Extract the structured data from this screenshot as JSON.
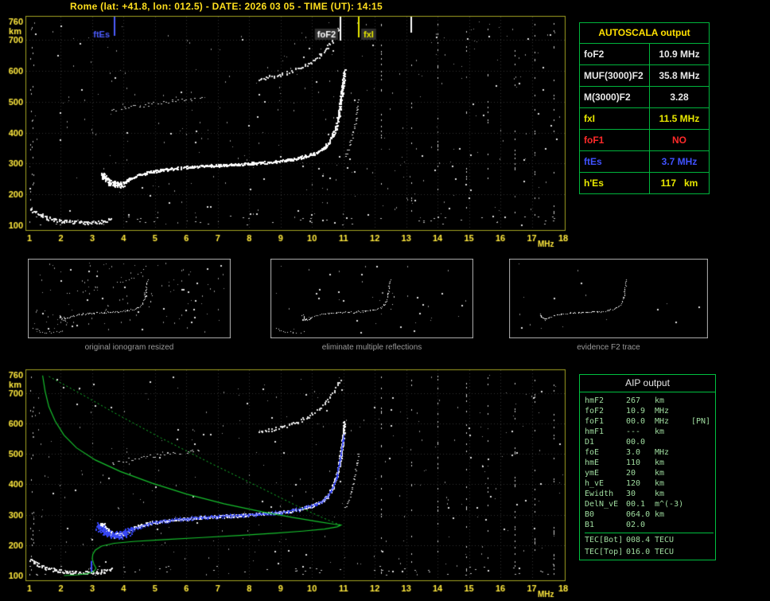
{
  "header": {
    "title": "Rome (lat: +41.8, lon: 012.5) - DATE: 2026 03 05 - TIME (UT): 14:15"
  },
  "tables": {
    "autoscala": {
      "title": "AUTOSCALA output",
      "rows": [
        {
          "label": "foF2",
          "value": "10.9 MHz",
          "color": "#e8e8e8"
        },
        {
          "label": "MUF(3000)F2",
          "value": "35.8 MHz",
          "color": "#e8e8e8"
        },
        {
          "label": "M(3000)F2",
          "value": "3.28",
          "color": "#e8e8e8"
        },
        {
          "label": "fxI",
          "value": "11.5 MHz",
          "color": "#e8e800"
        },
        {
          "label": "foF1",
          "value": "NO",
          "color": "#ff2a2a"
        },
        {
          "label": "ftEs",
          "value": "3.7 MHz",
          "color": "#4052ff"
        },
        {
          "label": "h'Es",
          "value": "117   km",
          "color": "#e8e800"
        }
      ]
    },
    "aip": {
      "title": "AIP output",
      "rows": [
        {
          "name": "hmF2",
          "value": "267",
          "unit": "km",
          "extra": ""
        },
        {
          "name": "foF2",
          "value": "10.9",
          "unit": "MHz",
          "extra": ""
        },
        {
          "name": "foF1",
          "value": "00.0",
          "unit": "MHz",
          "extra": "[PN]"
        },
        {
          "name": "hmF1",
          "value": "---",
          "unit": "km",
          "extra": ""
        },
        {
          "name": "D1",
          "value": "00.0",
          "unit": "",
          "extra": ""
        },
        {
          "name": "foE",
          "value": "3.0",
          "unit": "MHz",
          "extra": ""
        },
        {
          "name": "hmE",
          "value": "110",
          "unit": "km",
          "extra": ""
        },
        {
          "name": "ymE",
          "value": "20",
          "unit": "km",
          "extra": ""
        },
        {
          "name": "h_vE",
          "value": "120",
          "unit": "km",
          "extra": ""
        },
        {
          "name": "Ewidth",
          "value": "30",
          "unit": "km",
          "extra": ""
        },
        {
          "name": "DelN_vE",
          "value": "00.1",
          "unit": "m^(-3)",
          "extra": ""
        },
        {
          "name": "B0",
          "value": "064.0",
          "unit": "km",
          "extra": ""
        },
        {
          "name": "B1",
          "value": "02.0",
          "unit": "",
          "extra": ""
        },
        {
          "name": "TEC[Bot]",
          "value": "008.4",
          "unit": "TECU",
          "extra": ""
        },
        {
          "name": "TEC[Top]",
          "value": "016.0",
          "unit": "TECU",
          "extra": ""
        }
      ]
    }
  },
  "thumbnails": [
    {
      "caption": "original ionogram resized",
      "traces": [
        "e_layer",
        "f_cusp",
        "f_trace",
        "x_trace",
        "multiple_f",
        "multiple_low"
      ],
      "noise": 130
    },
    {
      "caption": "eliminate multiple reflections",
      "traces": [
        "e_layer",
        "f_cusp",
        "f_trace",
        "x_trace"
      ],
      "noise": 45
    },
    {
      "caption": "evidence F2 trace",
      "traces": [
        "f_cusp",
        "f_trace"
      ],
      "noise": 16
    }
  ],
  "chart_data": {
    "type": "scatter",
    "title": "Ionogram",
    "x_label": "MHz",
    "y_label": "km",
    "x_range": [
      1,
      18
    ],
    "y_range": [
      100,
      760
    ],
    "x_ticks": [
      1,
      2,
      3,
      4,
      5,
      6,
      7,
      8,
      9,
      10,
      11,
      12,
      13,
      14,
      15,
      16,
      17,
      18
    ],
    "y_ticks": [
      100,
      200,
      300,
      400,
      500,
      600,
      700,
      760
    ],
    "grid": true,
    "colors": {
      "trace": "#ffffff",
      "blue_overlay": "#2b3cf0",
      "profile_green": "#17c22e",
      "axis_yellow": "#ffe93e"
    },
    "scaled_values": {
      "foF2_mhz": 10.9,
      "fxI_mhz": 11.5,
      "ftEs_mhz": 3.7,
      "hEs_km": 117,
      "hmF2_km": 267,
      "foE_mhz": 3.0,
      "hmE_km": 110
    },
    "markers": [
      {
        "name": "ftEs",
        "label": "ftEs",
        "freq_mhz": 3.7,
        "color": "#4d5dff",
        "side": "left",
        "len": 24,
        "bg": false
      },
      {
        "name": "foF2",
        "label": "foF2",
        "freq_mhz": 10.9,
        "color": "#ffffff",
        "side": "left",
        "len": 30,
        "bg": true
      },
      {
        "name": "fxI",
        "label": "fxI",
        "freq_mhz": 11.5,
        "color": "#e8e800",
        "side": "right",
        "len": 26,
        "bg": true
      }
    ],
    "traces": {
      "e_layer": [
        [
          1.0,
          152
        ],
        [
          1.25,
          136
        ],
        [
          1.55,
          124
        ],
        [
          1.9,
          116
        ],
        [
          2.3,
          111
        ],
        [
          2.8,
          109
        ],
        [
          3.2,
          110
        ],
        [
          3.45,
          114
        ],
        [
          3.6,
          121
        ]
      ],
      "f_cusp": [
        [
          3.3,
          268
        ],
        [
          3.42,
          252
        ],
        [
          3.55,
          241
        ],
        [
          3.7,
          234
        ],
        [
          3.85,
          231
        ],
        [
          4.0,
          235
        ]
      ],
      "f_trace": [
        [
          4.0,
          237
        ],
        [
          4.2,
          249
        ],
        [
          4.5,
          263
        ],
        [
          4.9,
          274
        ],
        [
          5.5,
          283
        ],
        [
          6.2,
          289
        ],
        [
          7.0,
          294
        ],
        [
          7.8,
          298
        ],
        [
          8.5,
          303
        ],
        [
          9.1,
          309
        ],
        [
          9.6,
          318
        ],
        [
          10.0,
          329
        ],
        [
          10.3,
          344
        ],
        [
          10.5,
          363
        ],
        [
          10.65,
          388
        ],
        [
          10.77,
          420
        ],
        [
          10.86,
          460
        ],
        [
          10.93,
          510
        ],
        [
          10.99,
          558
        ],
        [
          11.04,
          605
        ]
      ],
      "x_trace": [
        [
          11.05,
          320
        ],
        [
          11.18,
          352
        ],
        [
          11.3,
          395
        ],
        [
          11.4,
          448
        ],
        [
          11.47,
          505
        ]
      ],
      "multiple_f": [
        [
          8.3,
          572
        ],
        [
          8.8,
          583
        ],
        [
          9.3,
          597
        ],
        [
          9.7,
          613
        ],
        [
          10.05,
          634
        ],
        [
          10.35,
          660
        ],
        [
          10.6,
          690
        ],
        [
          10.78,
          722
        ],
        [
          10.9,
          748
        ]
      ],
      "multiple_low": [
        [
          3.6,
          468
        ],
        [
          4.1,
          480
        ],
        [
          4.7,
          490
        ],
        [
          5.3,
          498
        ],
        [
          5.9,
          506
        ],
        [
          6.5,
          514
        ]
      ]
    },
    "overlays": {
      "blue_trace": [
        [
          3.15,
          266
        ],
        [
          3.3,
          252
        ],
        [
          3.45,
          242
        ],
        [
          3.6,
          236
        ],
        [
          3.8,
          233
        ],
        [
          4.0,
          237
        ],
        [
          4.25,
          250
        ],
        [
          4.6,
          264
        ],
        [
          5.0,
          275
        ],
        [
          5.6,
          284
        ],
        [
          6.3,
          290
        ],
        [
          7.1,
          295
        ],
        [
          7.9,
          299
        ],
        [
          8.6,
          304
        ],
        [
          9.2,
          311
        ],
        [
          9.7,
          320
        ],
        [
          10.05,
          331
        ],
        [
          10.35,
          347
        ],
        [
          10.55,
          367
        ],
        [
          10.7,
          394
        ],
        [
          10.8,
          428
        ],
        [
          10.88,
          468
        ],
        [
          10.95,
          515
        ],
        [
          11.01,
          560
        ]
      ],
      "profile_solid": [
        [
          1.42,
          758
        ],
        [
          1.5,
          706
        ],
        [
          1.62,
          655
        ],
        [
          1.82,
          608
        ],
        [
          2.1,
          562
        ],
        [
          2.5,
          520
        ],
        [
          3.1,
          480
        ],
        [
          3.9,
          442
        ],
        [
          4.9,
          404
        ],
        [
          6.0,
          368
        ],
        [
          7.2,
          336
        ],
        [
          8.4,
          310
        ],
        [
          9.4,
          291
        ],
        [
          10.2,
          277
        ],
        [
          10.7,
          269
        ],
        [
          10.92,
          266
        ],
        [
          10.8,
          260
        ],
        [
          10.4,
          253
        ],
        [
          9.7,
          246
        ],
        [
          8.8,
          239
        ],
        [
          7.7,
          232
        ],
        [
          6.5,
          225
        ],
        [
          5.3,
          218
        ],
        [
          4.3,
          212
        ],
        [
          3.7,
          206
        ],
        [
          3.3,
          197
        ],
        [
          3.1,
          184
        ],
        [
          3.02,
          170
        ],
        [
          3.0,
          155
        ],
        [
          3.05,
          138
        ],
        [
          3.12,
          124
        ],
        [
          3.05,
          113
        ],
        [
          2.85,
          106
        ],
        [
          2.5,
          102
        ],
        [
          2.1,
          100
        ]
      ],
      "profile_dotted": [
        [
          1.62,
          755
        ],
        [
          2.6,
          700
        ],
        [
          3.8,
          630
        ],
        [
          5.2,
          552
        ],
        [
          6.8,
          468
        ],
        [
          8.3,
          392
        ],
        [
          9.5,
          330
        ],
        [
          10.3,
          292
        ],
        [
          10.75,
          272
        ],
        [
          10.92,
          266
        ]
      ],
      "es_marker": {
        "freq_mhz": 2.97,
        "h_from": 112,
        "h_to": 148,
        "color": "#3a4cff"
      }
    },
    "rfi_columns_mhz": [
      12.2,
      13.17,
      14.0,
      14.9,
      15.6,
      16.45,
      17.1,
      17.7
    ],
    "rfi_top_tick_mhz": 13.17
  }
}
